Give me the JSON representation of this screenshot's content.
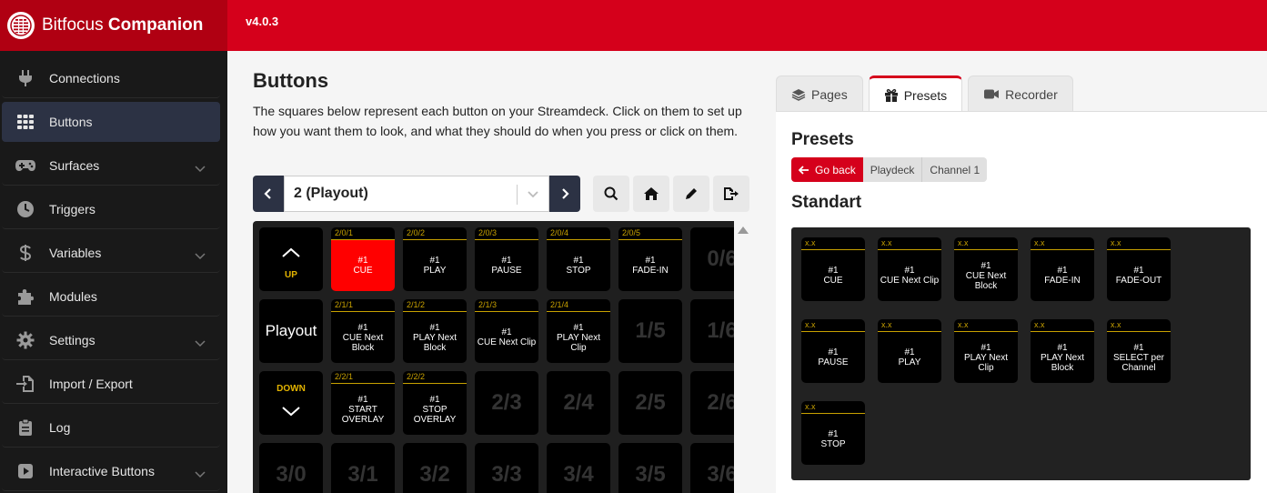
{
  "app": {
    "brand_light": "Bitfocus",
    "brand_bold": "Companion",
    "version": "v4.0.3"
  },
  "colors": {
    "brand_red": "#d5001b",
    "sidebar_bg": "#191919",
    "active_nav": "#2c3244",
    "header_gold": "#c8a100"
  },
  "sidebar": {
    "items": [
      {
        "label": "Connections",
        "icon": "plug-icon",
        "has_chevron": false,
        "active": false
      },
      {
        "label": "Buttons",
        "icon": "grid-icon",
        "has_chevron": false,
        "active": true
      },
      {
        "label": "Surfaces",
        "icon": "gamepad-icon",
        "has_chevron": true,
        "active": false
      },
      {
        "label": "Triggers",
        "icon": "clock-icon",
        "has_chevron": false,
        "active": false
      },
      {
        "label": "Variables",
        "icon": "dollar-icon",
        "has_chevron": true,
        "active": false
      },
      {
        "label": "Modules",
        "icon": "puzzle-icon",
        "has_chevron": false,
        "active": false
      },
      {
        "label": "Settings",
        "icon": "gear-icon",
        "has_chevron": true,
        "active": false
      },
      {
        "label": "Import / Export",
        "icon": "file-import-icon",
        "has_chevron": false,
        "active": false
      },
      {
        "label": "Log",
        "icon": "clipboard-icon",
        "has_chevron": false,
        "active": false
      },
      {
        "label": "Interactive Buttons",
        "icon": "play-square-icon",
        "has_chevron": true,
        "active": false
      }
    ]
  },
  "buttons_page": {
    "title": "Buttons",
    "description": "The squares below represent each button on your Streamdeck. Click on them to set up how you want them to look, and what they should do when you press or click on them.",
    "page_select_value": "2 (Playout)",
    "tools": [
      "search-icon",
      "home-icon",
      "pencil-icon",
      "export-icon"
    ]
  },
  "grid": {
    "rows": [
      [
        {
          "kind": "nav",
          "label": "UP",
          "arrow": "up"
        },
        {
          "kind": "btn",
          "header": "2/0/1",
          "text": [
            "#1",
            "CUE"
          ],
          "red": true
        },
        {
          "kind": "btn",
          "header": "2/0/2",
          "text": [
            "#1",
            "PLAY"
          ]
        },
        {
          "kind": "btn",
          "header": "2/0/3",
          "text": [
            "#1",
            "PAUSE"
          ]
        },
        {
          "kind": "btn",
          "header": "2/0/4",
          "text": [
            "#1",
            "STOP"
          ]
        },
        {
          "kind": "btn",
          "header": "2/0/5",
          "text": [
            "#1",
            "FADE-IN"
          ]
        },
        {
          "kind": "empty",
          "label": "0/6"
        }
      ],
      [
        {
          "kind": "name",
          "label": "Playout"
        },
        {
          "kind": "btn",
          "header": "2/1/1",
          "text": [
            "#1",
            "CUE Next",
            "Block"
          ]
        },
        {
          "kind": "btn",
          "header": "2/1/2",
          "text": [
            "#1",
            "PLAY Next",
            "Block"
          ]
        },
        {
          "kind": "btn",
          "header": "2/1/3",
          "text": [
            "#1",
            "CUE Next Clip"
          ]
        },
        {
          "kind": "btn",
          "header": "2/1/4",
          "text": [
            "#1",
            "PLAY Next Clip"
          ]
        },
        {
          "kind": "empty",
          "label": "1/5"
        },
        {
          "kind": "empty",
          "label": "1/6"
        }
      ],
      [
        {
          "kind": "nav",
          "label": "DOWN",
          "arrow": "down"
        },
        {
          "kind": "btn",
          "header": "2/2/1",
          "text": [
            "#1",
            "START",
            "OVERLAY"
          ]
        },
        {
          "kind": "btn",
          "header": "2/2/2",
          "text": [
            "#1",
            "STOP",
            "OVERLAY"
          ]
        },
        {
          "kind": "empty",
          "label": "2/3"
        },
        {
          "kind": "empty",
          "label": "2/4"
        },
        {
          "kind": "empty",
          "label": "2/5"
        },
        {
          "kind": "empty",
          "label": "2/6"
        }
      ],
      [
        {
          "kind": "empty",
          "label": "3/0"
        },
        {
          "kind": "empty",
          "label": "3/1"
        },
        {
          "kind": "empty",
          "label": "3/2"
        },
        {
          "kind": "empty",
          "label": "3/3"
        },
        {
          "kind": "empty",
          "label": "3/4"
        },
        {
          "kind": "empty",
          "label": "3/5"
        },
        {
          "kind": "empty",
          "label": "3/6"
        }
      ]
    ]
  },
  "right_panel": {
    "tabs": [
      {
        "label": "Pages",
        "icon": "layers-icon",
        "active": false
      },
      {
        "label": "Presets",
        "icon": "gift-icon",
        "active": true
      },
      {
        "label": "Recorder",
        "icon": "video-icon",
        "active": false
      }
    ],
    "title": "Presets",
    "back_label": "Go back",
    "crumbs": [
      "Playdeck",
      "Channel 1"
    ],
    "section_title": "Standart",
    "presets": [
      {
        "header": "x.x",
        "text": [
          "#1",
          "CUE"
        ]
      },
      {
        "header": "x.x",
        "text": [
          "#1",
          "CUE Next Clip"
        ]
      },
      {
        "header": "x.x",
        "text": [
          "#1",
          "CUE Next",
          "Block"
        ]
      },
      {
        "header": "x.x",
        "text": [
          "#1",
          "FADE-IN"
        ]
      },
      {
        "header": "x.x",
        "text": [
          "#1",
          "FADE-OUT"
        ]
      },
      {
        "header": "x.x",
        "text": [
          "#1",
          "PAUSE"
        ]
      },
      {
        "header": "x.x",
        "text": [
          "#1",
          "PLAY"
        ]
      },
      {
        "header": "x.x",
        "text": [
          "#1",
          "PLAY Next Clip"
        ]
      },
      {
        "header": "x.x",
        "text": [
          "#1",
          "PLAY Next",
          "Block"
        ]
      },
      {
        "header": "x.x",
        "text": [
          "#1",
          "SELECT per",
          "Channel"
        ]
      },
      {
        "header": "x.x",
        "text": [
          "#1",
          "STOP"
        ]
      }
    ]
  }
}
